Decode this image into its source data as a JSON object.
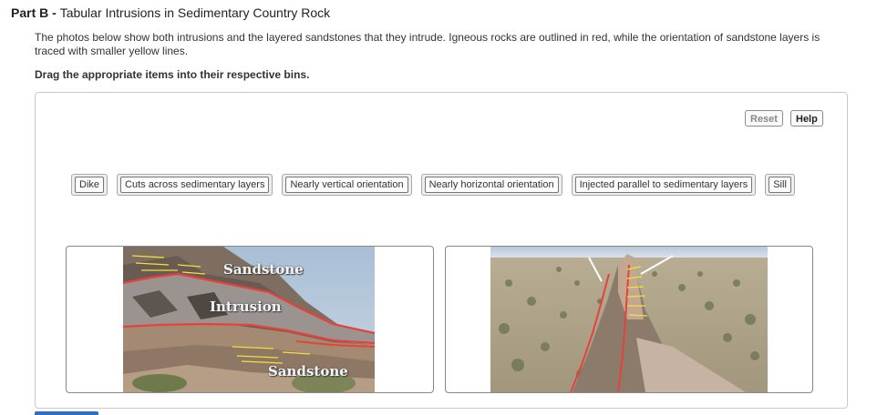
{
  "header": {
    "part_label": "Part B",
    "separator": " - ",
    "title": "Tabular Intrusions in Sedimentary Country Rock"
  },
  "description": "The photos below show both intrusions and the layered sandstones that they intrude. Igneous rocks are outlined in red, while the orientation of sandstone layers is traced with smaller yellow lines.",
  "instruction": "Drag the appropriate items into their respective bins.",
  "toolbar": {
    "reset_label": "Reset",
    "help_label": "Help"
  },
  "items": [
    {
      "label": "Dike"
    },
    {
      "label": "Cuts across sedimentary layers"
    },
    {
      "label": "Nearly vertical orientation"
    },
    {
      "label": "Nearly horizontal orientation"
    },
    {
      "label": "Injected parallel to sedimentary layers"
    },
    {
      "label": "Sill"
    }
  ],
  "bins": [
    {
      "photo_labels": {
        "top": "Sandstone",
        "middle": "Intrusion",
        "bottom": "Sandstone"
      }
    },
    {
      "photo_labels": {}
    }
  ],
  "colors": {
    "igneous_outline": "#e8413c",
    "sandstone_trace": "#f3e03a",
    "accent": "#2f6fc2"
  }
}
